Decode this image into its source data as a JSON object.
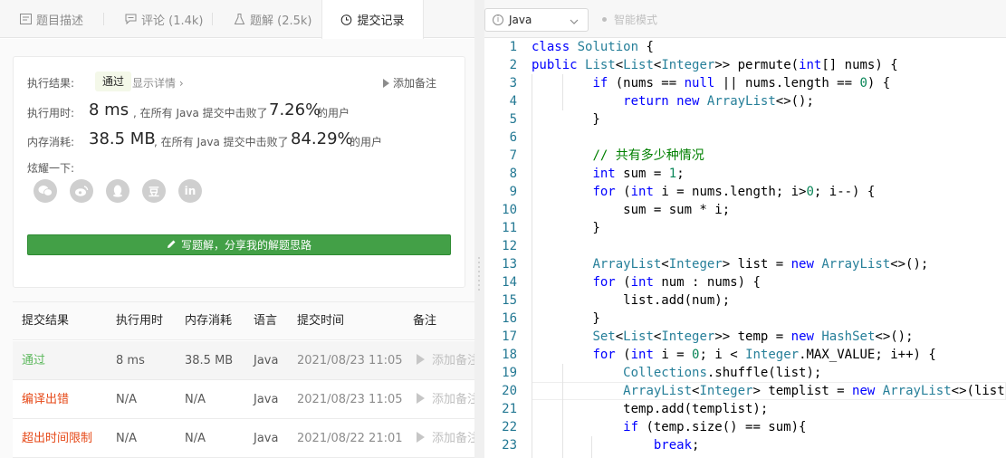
{
  "tabs": [
    {
      "label": "题目描述",
      "icon": "description-icon"
    },
    {
      "label": "评论 (1.4k)",
      "icon": "comment-icon"
    },
    {
      "label": "题解 (2.5k)",
      "icon": "flask-icon"
    },
    {
      "label": "提交记录",
      "icon": "clock-icon",
      "active": true
    }
  ],
  "result": {
    "exec_result_label": "执行结果:",
    "status": "通过",
    "show_detail": "显示详情 ›",
    "add_note": "添加备注",
    "time_label": "执行用时:",
    "time_value": "8 ms",
    "time_beat_prefix": ", 在所有 Java 提交中击败了",
    "time_percent": "7.26%",
    "users_suffix": "的用户",
    "memory_label": "内存消耗:",
    "memory_value": "38.5 MB",
    "memory_beat_prefix": ", 在所有 Java 提交中击败了",
    "memory_percent": "84.29%",
    "share_label": "炫耀一下:",
    "share_icons": [
      "wechat-icon",
      "weibo-icon",
      "qq-icon",
      "douban-icon",
      "linkedin-icon"
    ],
    "share_glyphs": {
      "douban": "豆",
      "linkedin": "in"
    },
    "write_button": "写题解，分享我的解题思路"
  },
  "table": {
    "headers": [
      "提交结果",
      "执行用时",
      "内存消耗",
      "语言",
      "提交时间",
      "备注"
    ],
    "rows": [
      {
        "status": "通过",
        "time": "8 ms",
        "memory": "38.5 MB",
        "lang": "Java",
        "submitted": "2021/08/23 11:05",
        "note": "添加备注"
      },
      {
        "status": "编译出错",
        "time": "N/A",
        "memory": "N/A",
        "lang": "Java",
        "submitted": "2021/08/23 11:05",
        "note": "添加备注"
      },
      {
        "status": "超出时间限制",
        "time": "N/A",
        "memory": "N/A",
        "lang": "Java",
        "submitted": "2021/08/22 21:01",
        "note": "添加备注"
      }
    ]
  },
  "editor": {
    "language": "Java",
    "smart_mode": "智能模式",
    "line_numbers": [
      "1",
      "2",
      "3",
      "4",
      "5",
      "6",
      "7",
      "8",
      "9",
      "10",
      "11",
      "12",
      "13",
      "14",
      "15",
      "16",
      "17",
      "18",
      "19",
      "20",
      "21",
      "22",
      "23"
    ],
    "lines": [
      "class Solution {",
      "public List<List<Integer>> permute(int[] nums) {",
      "        if (nums == null || nums.length == 0) {",
      "            return new ArrayList<>();",
      "        }",
      "",
      "        // 共有多少种情况",
      "        int sum = 1;",
      "        for (int i = nums.length; i>0; i--) {",
      "            sum = sum * i;",
      "        }",
      "",
      "        ArrayList<Integer> list = new ArrayList<>();",
      "        for (int num : nums) {",
      "            list.add(num);",
      "        }",
      "        Set<List<Integer>> temp = new HashSet<>();",
      "        for (int i = 0; i < Integer.MAX_VALUE; i++) {",
      "            Collections.shuffle(list);",
      "            ArrayList<Integer> templist = new ArrayList<>(list);",
      "            temp.add(templist);",
      "            if (temp.size() == sum){",
      "                break;"
    ]
  }
}
